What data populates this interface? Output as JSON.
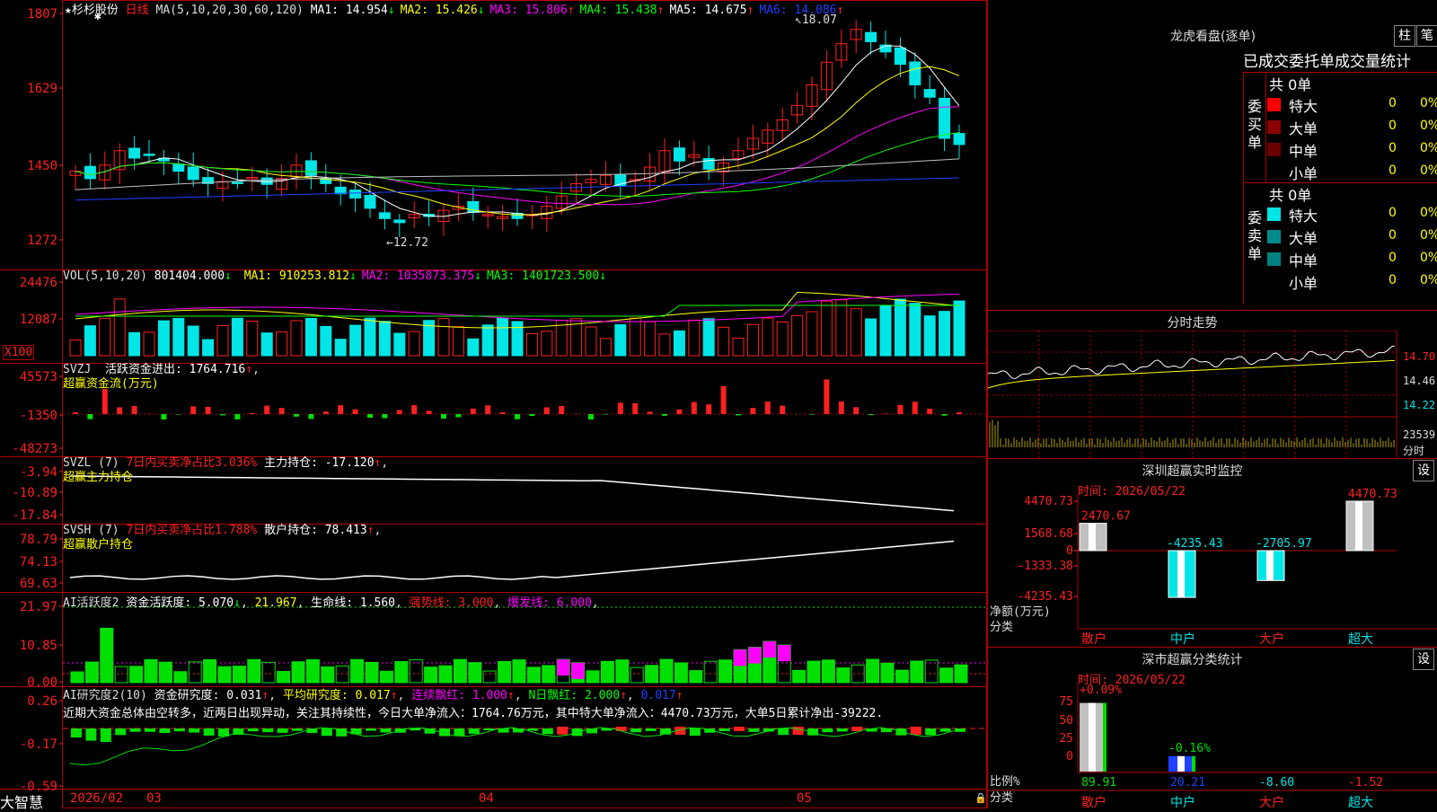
{
  "stock": {
    "star": "★",
    "name": "杉杉股份",
    "period": "日线"
  },
  "colors": {
    "bg": "#000000",
    "grid": "#B00000",
    "up": "#FF2020",
    "down": "#00E5E5",
    "ma1": "#FFFFFF",
    "ma2": "#FFFF00",
    "ma3": "#FF00FF",
    "ma4": "#00FF00",
    "ma5": "#C0C0C0",
    "ma6": "#2040FF"
  },
  "main": {
    "ma_label": "MA(5,10,20,30,60,120)",
    "ma": [
      {
        "name": "MA1",
        "value": "14.954",
        "arrow": "↓",
        "color": "#FFFFFF"
      },
      {
        "name": "MA2",
        "value": "15.426",
        "arrow": "↓",
        "color": "#FFFF00"
      },
      {
        "name": "MA3",
        "value": "15.806",
        "arrow": "↑",
        "color": "#FF00FF"
      },
      {
        "name": "MA4",
        "value": "15.438",
        "arrow": "↑",
        "color": "#00FF00"
      },
      {
        "name": "MA5",
        "value": "14.675",
        "arrow": "↑",
        "color": "#FFFFFF"
      },
      {
        "name": "MA6",
        "value": "14.086",
        "arrow": "↑",
        "color": "#2040FF"
      }
    ],
    "y_labels": [
      "1807",
      "1629",
      "1450",
      "1272"
    ],
    "high_mark": "18.07",
    "low_mark": "←12.72"
  },
  "vol": {
    "label": "VOL(5,10,20)",
    "value": "801404.000",
    "arrow": "↓",
    "ma": [
      {
        "name": "MA1",
        "value": "910253.812",
        "arrow": "↓",
        "color": "#FFFF00"
      },
      {
        "name": "MA2",
        "value": "1035873.375",
        "arrow": "↓",
        "color": "#FF00FF"
      },
      {
        "name": "MA3",
        "value": "1401723.500",
        "arrow": "↓",
        "color": "#00FF00"
      }
    ],
    "y_labels": [
      "24476",
      "12087"
    ],
    "unit": "X100"
  },
  "svzj": {
    "label": "SVZJ",
    "desc": "活跃资金进出:",
    "value": "1764.716",
    "arrow": "↑",
    "sub": "超赢资金流(万元)",
    "y_labels": [
      "45573",
      "-1350",
      "-48273"
    ]
  },
  "svzl": {
    "label": "SVZL (7)",
    "desc": "7日内买卖净占比3.036%",
    "desc2": "主力持仓:",
    "value": "-17.120",
    "arrow": "↑",
    "sub": "超赢主力持仓",
    "y_labels": [
      "-3.94",
      "-10.89",
      "-17.84"
    ]
  },
  "svsh": {
    "label": "SVSH (7)",
    "desc": "7日内买卖净占比1.788%",
    "desc2": "散户持仓:",
    "value": "78.413",
    "arrow": "↑",
    "sub": "超赢散户持仓",
    "y_labels": [
      "78.79",
      "74.13",
      "69.63"
    ]
  },
  "ai1": {
    "label": "AI活跃度2",
    "d1": "资金活跃度:",
    "v1": "5.070",
    "a1": "↓",
    "v2": "21.967",
    "d3": "生命线:",
    "v3": "1.560",
    "d4": "强势线:",
    "v4": "3.000",
    "d5": "爆发线:",
    "v5": "6.000",
    "y_labels": [
      "21.97",
      "10.85",
      "0.00"
    ]
  },
  "ai2": {
    "label": "AI研究度2(10)",
    "d1": "资金研究度:",
    "v1": "0.031",
    "a1": "↑",
    "d2": "平均研究度:",
    "v2": "0.017",
    "a2": "↑",
    "d3": "连续飘红:",
    "v3": "1.000",
    "a3": "↑",
    "d4": "N日飘红:",
    "v4": "2.000",
    "a4": "↑",
    "v5": "0.017",
    "a5": "↑",
    "comment": "近期大资金总体由空转多，近两日出现异动，关注其持续性，今日大单净流入：1764.76万元，其中特大单净流入：4470.73万元，大单5日累计净出-39222.",
    "y_labels": [
      "0.26",
      "-0.17",
      "-0.59"
    ]
  },
  "xaxis": {
    "brand": "大智慧",
    "labels": [
      "2026/02",
      "03",
      "04",
      "05"
    ]
  },
  "dragon": {
    "title": "龙虎看盘(逐单)",
    "btn1": "柱",
    "btn2": "笔",
    "tabs": [
      "已成交",
      "委托单",
      "成交量统计"
    ],
    "buy_label": "委买单",
    "sell_label": "委卖单",
    "buy_total": "共 0单",
    "sell_total": "共 0单",
    "buy_rows": [
      {
        "name": "特大",
        "val": "0",
        "pct": "0%",
        "color": "#FF0000"
      },
      {
        "name": "大单",
        "val": "0",
        "pct": "0%",
        "color": "#8B0000"
      },
      {
        "name": "中单",
        "val": "0",
        "pct": "0%",
        "color": "#6B0000"
      },
      {
        "name": "小单",
        "val": "0",
        "pct": "0%",
        "color": ""
      }
    ],
    "sell_rows": [
      {
        "name": "特大",
        "val": "0",
        "pct": "0%",
        "color": "#00E5E5"
      },
      {
        "name": "大单",
        "val": "0",
        "pct": "0%",
        "color": "#008B8B"
      },
      {
        "name": "中单",
        "val": "0",
        "pct": "0%",
        "color": "#008080"
      },
      {
        "name": "小单",
        "val": "0",
        "pct": "0%",
        "color": ""
      }
    ]
  },
  "intraday": {
    "title": "分时走势",
    "y_labels": [
      "14.70",
      "14.46",
      "14.22",
      "23539"
    ],
    "unit": "分时"
  },
  "monitor": {
    "title": "深圳超赢实时监控",
    "btn": "设",
    "time": "时间: 2026/05/22",
    "y_labels": [
      "4470.73",
      "1568.68",
      "0",
      "-1333.38",
      "-4235.43"
    ],
    "footer_left": "净额(万元)",
    "footer_left2": "分类",
    "bars": [
      {
        "cat": "散户",
        "value": "2470.67"
      },
      {
        "cat": "中户",
        "value": "-4235.43"
      },
      {
        "cat": "大户",
        "value": "-2705.97"
      },
      {
        "cat": "超大",
        "value": "4470.73"
      }
    ]
  },
  "stats": {
    "title": "深市超赢分类统计",
    "btn": "设",
    "time": "时间: 2026/05/22",
    "y_labels": [
      "75",
      "50",
      "25",
      "0"
    ],
    "footer_left": "比例%",
    "footer_left2": "分类",
    "bars": [
      {
        "cat": "散户",
        "top": "+0.09%",
        "bottom": "89.91"
      },
      {
        "cat": "中户",
        "top": "-0.16%",
        "bottom": "20.21"
      },
      {
        "cat": "大户",
        "top": "",
        "bottom": "-8.60"
      },
      {
        "cat": "超大",
        "top": "",
        "bottom": "-1.52"
      }
    ]
  }
}
